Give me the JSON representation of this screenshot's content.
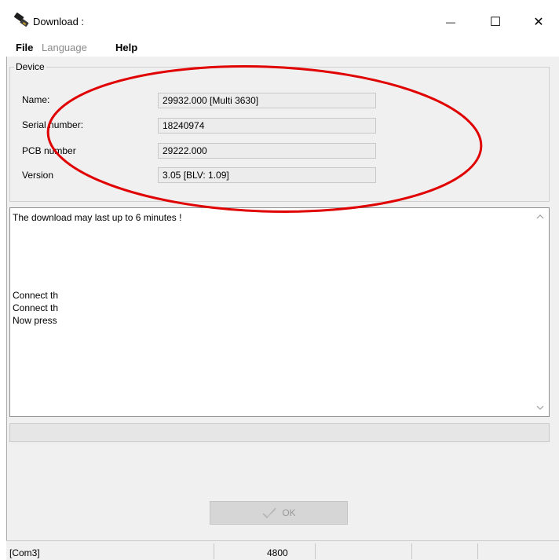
{
  "window": {
    "title": "Download :",
    "controls": {
      "minimize": "—",
      "maximize": "☐",
      "close": "✕"
    }
  },
  "menu": {
    "items": [
      {
        "label": "File",
        "enabled": true
      },
      {
        "label": "Language",
        "enabled": false
      },
      {
        "label": "Help",
        "enabled": true
      }
    ]
  },
  "device": {
    "group_title": "Device",
    "fields": [
      {
        "label": "Name:",
        "value": "29932.000  [Multi 3630]"
      },
      {
        "label": "Serial number:",
        "value": "18240974"
      },
      {
        "label": "PCB number",
        "value": "29222.000"
      },
      {
        "label": "Version",
        "value": "3.05  [BLV: 1.09]"
      }
    ]
  },
  "log": {
    "lines": [
      "The download may last up to 6 minutes !",
      "Connect th",
      "Connect th",
      "Now press"
    ]
  },
  "progress": {
    "fraction": 0
  },
  "ok_button": {
    "label": "OK",
    "enabled": false
  },
  "status_bar": {
    "port": "[Com3]",
    "baud": "4800"
  },
  "colors": {
    "annotation": "#e00000",
    "window_bg": "#f0f0f0",
    "field_bg": "#ececec"
  },
  "icons": {
    "app": "cable-plug-icon",
    "ok": "checkmark-icon"
  }
}
